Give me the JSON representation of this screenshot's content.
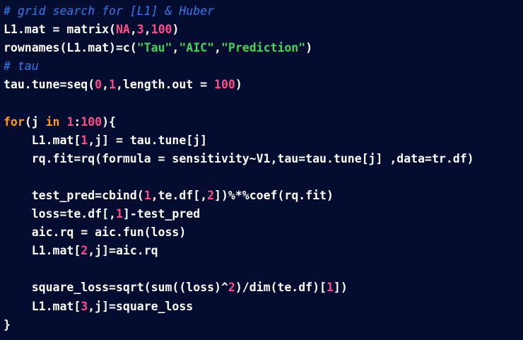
{
  "colors": {
    "background": "#040c30",
    "plain": "#ffffff",
    "comment": "#2e7cf0",
    "keyword": "#ff9a1a",
    "number": "#ff4c86",
    "string": "#41d35a"
  },
  "code": {
    "lines": [
      [
        {
          "t": "comment",
          "v": "# grid search for [L1] & Huber"
        }
      ],
      [
        {
          "t": "plain",
          "v": "L1.mat = matrix("
        },
        {
          "t": "number",
          "v": "NA"
        },
        {
          "t": "plain",
          "v": ","
        },
        {
          "t": "number",
          "v": "3"
        },
        {
          "t": "plain",
          "v": ","
        },
        {
          "t": "number",
          "v": "100"
        },
        {
          "t": "plain",
          "v": ")"
        }
      ],
      [
        {
          "t": "plain",
          "v": "rownames(L1.mat)=c("
        },
        {
          "t": "string",
          "v": "\"Tau\""
        },
        {
          "t": "plain",
          "v": ","
        },
        {
          "t": "string",
          "v": "\"AIC\""
        },
        {
          "t": "plain",
          "v": ","
        },
        {
          "t": "string",
          "v": "\"Prediction\""
        },
        {
          "t": "plain",
          "v": ")"
        }
      ],
      [
        {
          "t": "comment",
          "v": "# tau"
        }
      ],
      [
        {
          "t": "plain",
          "v": "tau.tune=seq("
        },
        {
          "t": "number",
          "v": "0"
        },
        {
          "t": "plain",
          "v": ","
        },
        {
          "t": "number",
          "v": "1"
        },
        {
          "t": "plain",
          "v": ",length.out = "
        },
        {
          "t": "number",
          "v": "100"
        },
        {
          "t": "plain",
          "v": ")"
        }
      ],
      [],
      [
        {
          "t": "keyword",
          "v": "for"
        },
        {
          "t": "plain",
          "v": "(j "
        },
        {
          "t": "keyword",
          "v": "in"
        },
        {
          "t": "plain",
          "v": " "
        },
        {
          "t": "number",
          "v": "1"
        },
        {
          "t": "plain",
          "v": ":"
        },
        {
          "t": "number",
          "v": "100"
        },
        {
          "t": "plain",
          "v": "){"
        }
      ],
      [
        {
          "t": "plain",
          "v": "    L1.mat["
        },
        {
          "t": "number",
          "v": "1"
        },
        {
          "t": "plain",
          "v": ",j] = tau.tune[j]"
        }
      ],
      [
        {
          "t": "plain",
          "v": "    rq.fit=rq(formula = sensitivity~V1,tau=tau.tune[j] ,data=tr.df)"
        }
      ],
      [],
      [
        {
          "t": "plain",
          "v": "    test_pred=cbind("
        },
        {
          "t": "number",
          "v": "1"
        },
        {
          "t": "plain",
          "v": ",te.df[,"
        },
        {
          "t": "number",
          "v": "2"
        },
        {
          "t": "plain",
          "v": "])%*%coef(rq.fit)"
        }
      ],
      [
        {
          "t": "plain",
          "v": "    loss=te.df[,"
        },
        {
          "t": "number",
          "v": "1"
        },
        {
          "t": "plain",
          "v": "]-test_pred"
        }
      ],
      [
        {
          "t": "plain",
          "v": "    aic.rq = aic.fun(loss)"
        }
      ],
      [
        {
          "t": "plain",
          "v": "    L1.mat["
        },
        {
          "t": "number",
          "v": "2"
        },
        {
          "t": "plain",
          "v": ",j]=aic.rq"
        }
      ],
      [],
      [
        {
          "t": "plain",
          "v": "    square_loss=sqrt(sum((loss)^"
        },
        {
          "t": "number",
          "v": "2"
        },
        {
          "t": "plain",
          "v": ")/dim(te.df)["
        },
        {
          "t": "number",
          "v": "1"
        },
        {
          "t": "plain",
          "v": "])"
        }
      ],
      [
        {
          "t": "plain",
          "v": "    L1.mat["
        },
        {
          "t": "number",
          "v": "3"
        },
        {
          "t": "plain",
          "v": ",j]=square_loss"
        }
      ],
      [
        {
          "t": "plain",
          "v": "}"
        }
      ]
    ]
  }
}
